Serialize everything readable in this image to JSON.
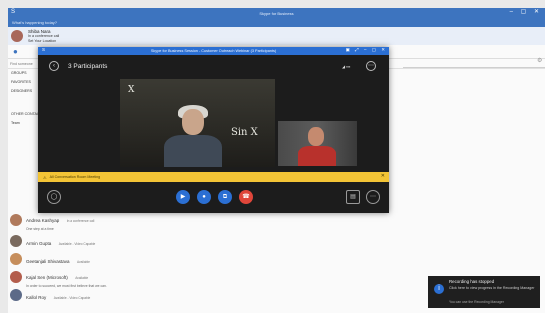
{
  "app": {
    "title": "Skype for Business"
  },
  "main_window": {
    "whats_happening": "What's happening today?",
    "profile": {
      "name": "Shiba Nara",
      "status": "In a conference call",
      "location": "Set Your Location"
    },
    "search_placeholder": "Find someone",
    "groups": [
      "GROUPS",
      "FAVORITES",
      "DESIGNERS"
    ],
    "other_contacts_label": "OTHER CONTACTS",
    "team_label": "Team",
    "contacts": [
      {
        "name": "Andrea Kashyap",
        "status": "In a conference call",
        "note": "One step at a time",
        "color": "#b07a5c"
      },
      {
        "name": "Armin Gupta",
        "status": "Available - Video Capable",
        "note": "",
        "color": "#7a6a5e"
      },
      {
        "name": "Geetanjali Shivastava",
        "status": "Available",
        "note": "",
        "color": "#c68e5c"
      },
      {
        "name": "Kajal Sen (Microsoft)",
        "status": "Available",
        "note": "In order to succeed, we must first believe that we can.",
        "color": "#b35d4c"
      },
      {
        "name": "Kallol Roy",
        "status": "Available - Video Capable",
        "note": "",
        "color": "#5c6a88"
      }
    ]
  },
  "meeting": {
    "title": "Skype for Business Session - Customer Outreach Webinar (3 Participants)",
    "participants_label": "3 Participants",
    "notice": "All Conversation Room Meeting",
    "board_text": {
      "a": "X",
      "b": "Sin X"
    }
  },
  "toast": {
    "title": "Recording has stopped",
    "body": "Click here to view progress in the Recording Manager",
    "footer": "You can use the Recording Manager"
  },
  "colors": {
    "accent": "#3d74bf",
    "notice": "#f3c436",
    "end_call": "#e0463a"
  }
}
